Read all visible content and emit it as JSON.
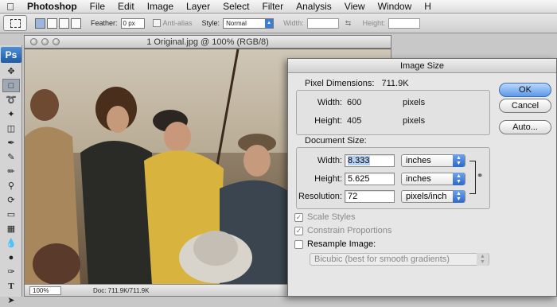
{
  "menubar": {
    "apple": "",
    "items": [
      "Photoshop",
      "File",
      "Edit",
      "Image",
      "Layer",
      "Select",
      "Filter",
      "Analysis",
      "View",
      "Window",
      "H"
    ]
  },
  "options": {
    "feather_label": "Feather:",
    "feather_value": "0 px",
    "antialias_label": "Anti-alias",
    "style_label": "Style:",
    "style_value": "Normal",
    "width_label": "Width:",
    "height_label": "Height:"
  },
  "tools": {
    "logo": "Ps"
  },
  "document": {
    "title": "1 Original.jpg @ 100% (RGB/8)",
    "zoom": "100%",
    "status": "Doc: 711.9K/711.9K"
  },
  "dialog": {
    "title": "Image Size",
    "pixel_dimensions": {
      "title": "Pixel Dimensions:",
      "size": "711.9K",
      "width_label": "Width:",
      "width_value": "600",
      "width_unit": "pixels",
      "height_label": "Height:",
      "height_value": "405",
      "height_unit": "pixels"
    },
    "document_size": {
      "title": "Document Size:",
      "width_label": "Width:",
      "width_value": "8.333",
      "width_unit": "inches",
      "height_label": "Height:",
      "height_value": "5.625",
      "height_unit": "inches",
      "resolution_label": "Resolution:",
      "resolution_value": "72",
      "resolution_unit": "pixels/inch"
    },
    "scale_styles": "Scale Styles",
    "constrain_proportions": "Constrain Proportions",
    "resample_image": "Resample Image:",
    "resample_method": "Bicubic (best for smooth gradients)",
    "buttons": {
      "ok": "OK",
      "cancel": "Cancel",
      "auto": "Auto..."
    }
  }
}
